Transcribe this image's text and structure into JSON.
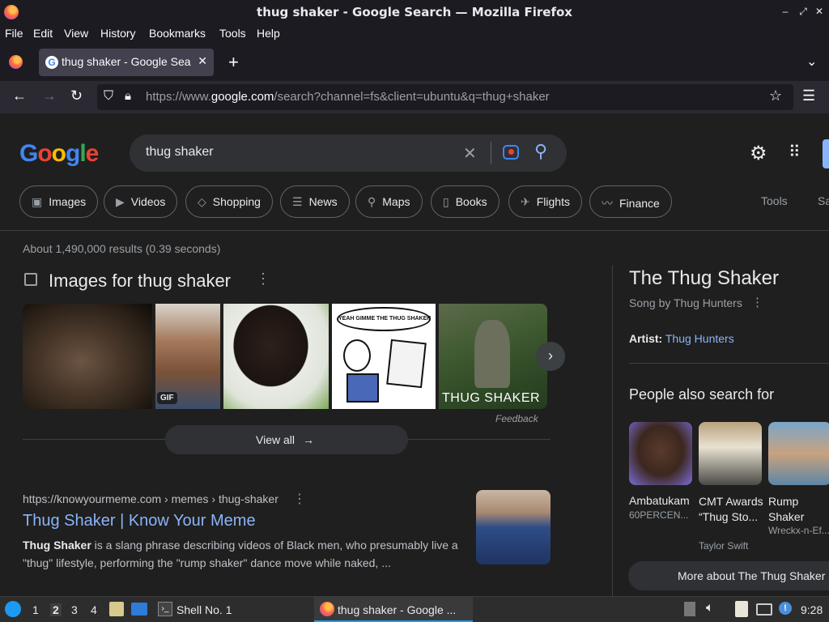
{
  "window": {
    "title": "thug shaker - Google Search — Mozilla Firefox"
  },
  "menu": [
    "File",
    "Edit",
    "View",
    "History",
    "Bookmarks",
    "Tools",
    "Help"
  ],
  "tab": {
    "title": "thug shaker - Google Search"
  },
  "url": {
    "prefix": "https://www.",
    "domain": "google.com",
    "path": "/search?channel=fs&client=ubuntu&q=thug+shaker"
  },
  "google": {
    "logo": "Google",
    "query": "thug shaker",
    "filters": [
      "Images",
      "Videos",
      "Shopping",
      "News",
      "Maps",
      "Books",
      "Flights",
      "Finance"
    ],
    "filter_icons": [
      "▣",
      "▶",
      "◇",
      "☰",
      "⚲",
      "▯",
      "✈",
      "〰"
    ],
    "tools": "Tools",
    "safesearch": "Sa",
    "stats": "About 1,490,000 results (0.39 seconds)",
    "images_heading": "Images for thug shaker",
    "thumb_labels": {
      "gif": "GIF",
      "meme_text": "YEAH GIMME THE THUG SHAKER",
      "caption": "THUG SHAKER"
    },
    "feedback": "Feedback",
    "view_all": "View all",
    "result": {
      "url": "https://knowyourmeme.com › memes › thug-shaker",
      "title": "Thug Shaker | Know Your Meme",
      "snippet_bold": "Thug Shaker",
      "snippet_rest": " is a slang phrase describing videos of Black men, who presumably live a",
      "snippet_line2": "\"thug\" lifestyle, performing the \"rump shaker\" dance move while naked, ..."
    },
    "panel": {
      "title": "The Thug Shaker",
      "subtitle": "Song by Thug Hunters",
      "artist_label": "Artist:",
      "artist_value": "Thug Hunters",
      "people_heading": "People also search for",
      "people": [
        {
          "name": "Ambatukam",
          "sub": "60PERCEN..."
        },
        {
          "name": "CMT Awards “Thug Sto...",
          "sub": "Taylor Swift"
        },
        {
          "name": "Rump Shaker",
          "sub": "Wreckx-n-Ef..."
        }
      ],
      "more": "More about The Thug Shaker"
    }
  },
  "taskbar": {
    "workspaces": [
      "1",
      "2",
      "3",
      "4"
    ],
    "shell": "Shell No. 1",
    "firefox": "thug shaker - Google ...",
    "time": "9:28"
  }
}
